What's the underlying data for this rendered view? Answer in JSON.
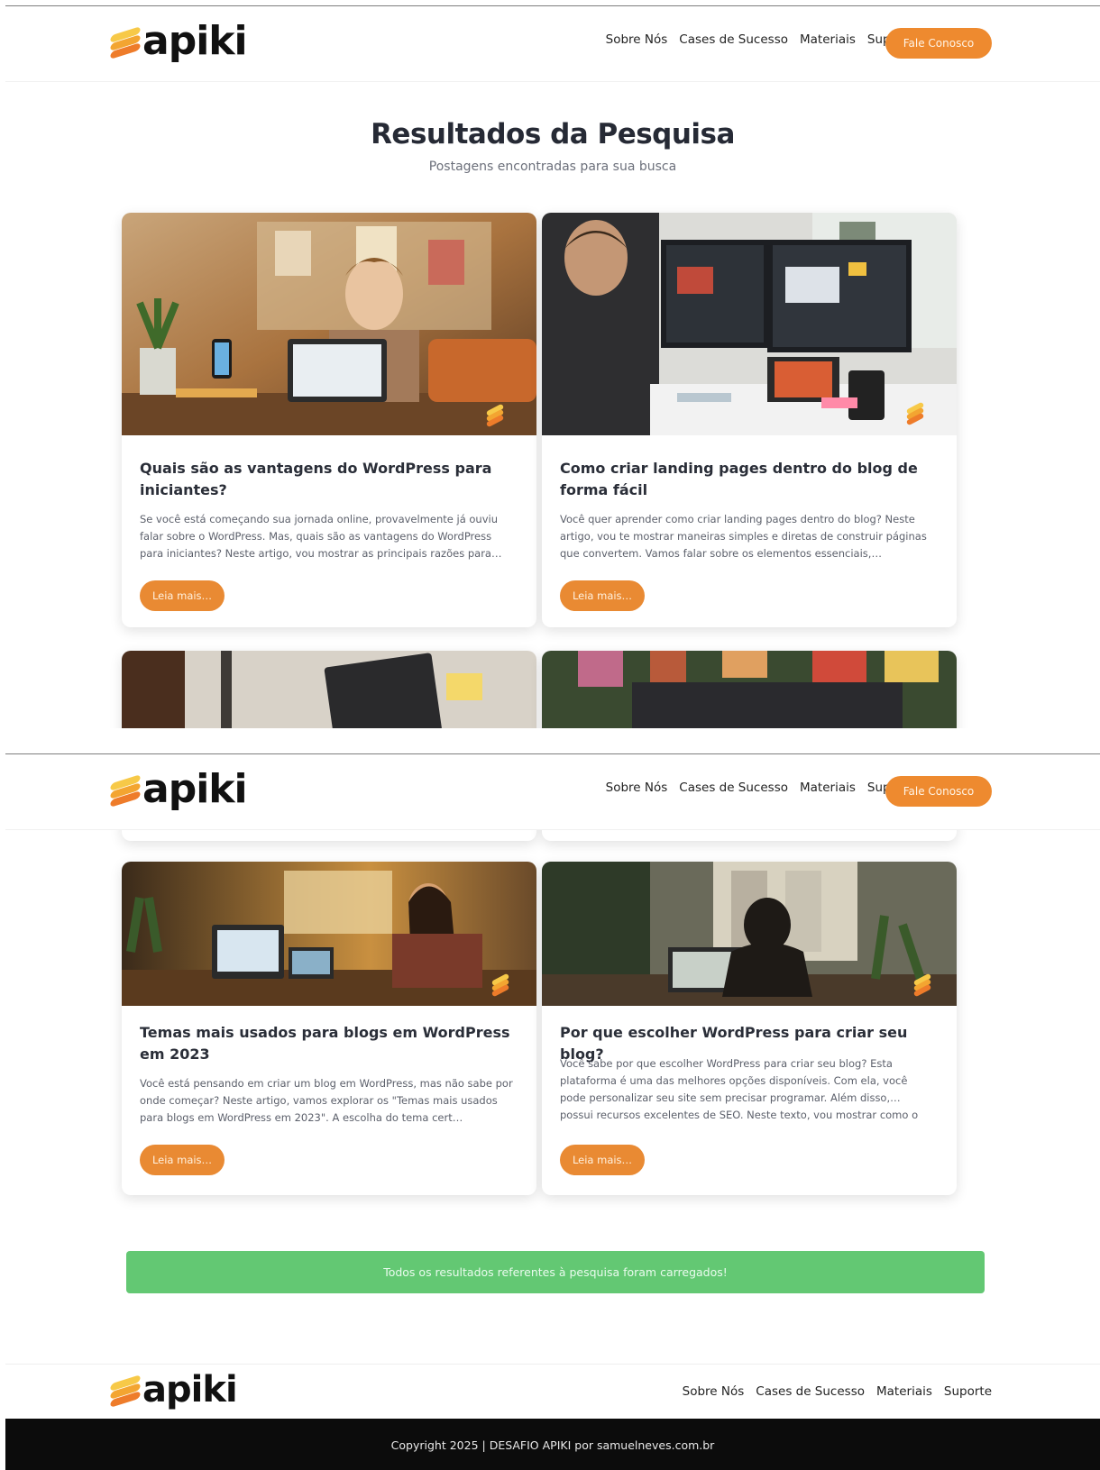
{
  "brand": {
    "name": "apiki",
    "colors": [
      "#f7c948",
      "#f3a531",
      "#ee7c2a"
    ]
  },
  "nav": {
    "items": [
      "Sobre Nós",
      "Cases de Sucesso",
      "Materiais",
      "Suporte"
    ],
    "search_icon": "search-icon",
    "cta_label": "Fale Conosco"
  },
  "search_page": {
    "title": "Resultados da Pesquisa",
    "subtitle": "Postagens encontradas para sua busca"
  },
  "posts": [
    {
      "title": "Quais são as vantagens do WordPress para iniciantes?",
      "excerpt": "Se você está começando sua jornada online, provavelmente já ouviu falar sobre o WordPress. Mas, quais são as vantagens do WordPress para iniciantes? Neste artigo, vou mostrar as principais razões para…",
      "button": "Leia mais…"
    },
    {
      "title": "Como criar landing pages dentro do blog de forma fácil",
      "excerpt": "Você quer aprender como criar landing pages dentro do blog? Neste artigo, vou te mostrar maneiras simples e diretas de construir páginas que convertem. Vamos falar sobre os elementos essenciais,…",
      "button": "Leia mais…"
    },
    {
      "title": "Temas mais usados para blogs em WordPress em 2023",
      "excerpt": "Você está pensando em criar um blog em WordPress, mas não sabe por onde começar? Neste artigo, vamos explorar os \"Temas mais usados para blogs em WordPress em 2023\". A escolha do tema cert…",
      "button": "Leia mais…"
    },
    {
      "title": "Por que escolher WordPress para criar seu blog?",
      "excerpt": "Você sabe por que escolher WordPress para criar seu blog? Esta plataforma é uma das melhores opções disponíveis. Com ela, você pode personalizar seu site sem precisar programar. Além disso,… possui recursos excelentes de SEO. Neste texto, vou mostrar como o",
      "button": "Leia mais…"
    }
  ],
  "status_message": "Todos os resultados referentes à pesquisa foram carregados!",
  "footer": {
    "nav": [
      "Sobre Nós",
      "Cases de Sucesso",
      "Materiais",
      "Suporte"
    ],
    "copyright": "Copyright 2025 | DESAFIO APIKI por samuelneves.com.br"
  }
}
